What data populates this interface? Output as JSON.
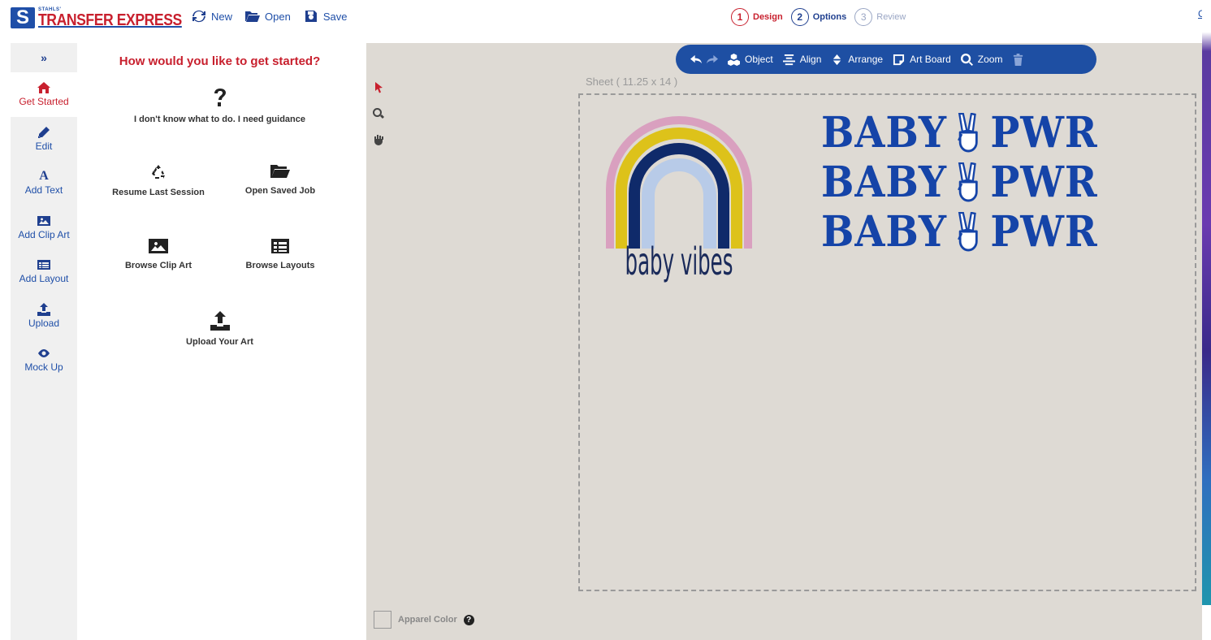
{
  "brand": {
    "small": "STAHLS'",
    "main": "TRANSFER EXPRESS",
    "icon_letter": "S"
  },
  "file_actions": [
    {
      "label": "New",
      "icon": "refresh-icon"
    },
    {
      "label": "Open",
      "icon": "folder-open-icon"
    },
    {
      "label": "Save",
      "icon": "save-icon"
    }
  ],
  "steps": [
    {
      "num": "1",
      "label": "Design"
    },
    {
      "num": "2",
      "label": "Options"
    },
    {
      "num": "3",
      "label": "Review"
    }
  ],
  "corner_link": "C",
  "leftnav": {
    "toggle": "»",
    "items": [
      {
        "label": "Get Started",
        "icon": "home-icon"
      },
      {
        "label": "Edit",
        "icon": "pencil-icon"
      },
      {
        "label": "Add Text",
        "icon": "text-a-icon"
      },
      {
        "label": "Add Clip Art",
        "icon": "image-icon"
      },
      {
        "label": "Add Layout",
        "icon": "layout-icon"
      },
      {
        "label": "Upload",
        "icon": "upload-icon"
      },
      {
        "label": "Mock Up",
        "icon": "eye-icon"
      }
    ]
  },
  "panel": {
    "title": "How would you like to get started?",
    "options": {
      "guidance": "I don't know what to do. I need guidance",
      "resume": "Resume Last Session",
      "open_saved": "Open Saved Job",
      "browse_clip": "Browse Clip Art",
      "browse_layouts": "Browse Layouts",
      "upload": "Upload Your Art"
    }
  },
  "toolbar": {
    "object": "Object",
    "align": "Align",
    "arrange": "Arrange",
    "artboard": "Art Board",
    "zoom": "Zoom"
  },
  "sheet_label": "Sheet ( 11.25 x 14 )",
  "apparel_color_label": "Apparel Color",
  "artwork": {
    "rainbow_text": "baby vibes",
    "pwr_lines": [
      {
        "left": "BABY",
        "right": "PWR"
      },
      {
        "left": "BABY",
        "right": "PWR"
      },
      {
        "left": "BABY",
        "right": "PWR"
      }
    ],
    "colors": {
      "pink": "#d9a0bf",
      "yellow": "#ddc21a",
      "navy": "#0f2a6a",
      "light_blue": "#b8cbe8",
      "royal": "#1544a8"
    }
  }
}
